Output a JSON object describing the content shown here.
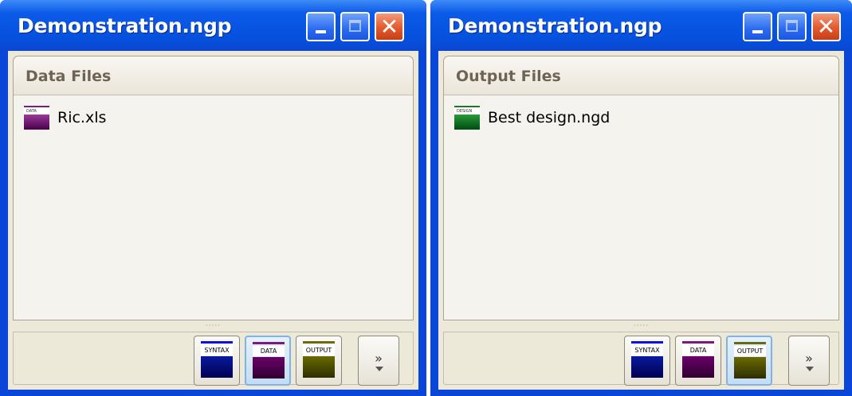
{
  "windows": [
    {
      "title": "Demonstration.ngp",
      "panel_title": "Data Files",
      "file": {
        "name": "Ric.xls",
        "icon": "data-file-icon",
        "icon_label": "DATA",
        "color": "#6b0a6b"
      },
      "toolbar": {
        "buttons": [
          {
            "label": "SYNTAX",
            "stripe": "#1010e0",
            "fill": "#00108a",
            "active": false
          },
          {
            "label": "DATA",
            "stripe": "#7a1c7a",
            "fill": "#5e005e",
            "active": true
          },
          {
            "label": "OUTPUT",
            "stripe": "#6b6a10",
            "fill": "#5a5a00",
            "active": false
          }
        ],
        "more": "»"
      }
    },
    {
      "title": "Demonstration.ngp",
      "panel_title": "Output Files",
      "file": {
        "name": "Best design.ngd",
        "icon": "design-file-icon",
        "icon_label": "DESIGN",
        "color": "#0a6b1a"
      },
      "toolbar": {
        "buttons": [
          {
            "label": "SYNTAX",
            "stripe": "#1010e0",
            "fill": "#00108a",
            "active": false
          },
          {
            "label": "DATA",
            "stripe": "#7a1c7a",
            "fill": "#5e005e",
            "active": false
          },
          {
            "label": "OUTPUT",
            "stripe": "#6b6a10",
            "fill": "#5a5a00",
            "active": true
          }
        ],
        "more": "»"
      }
    }
  ],
  "colors": {
    "titlebar": "#0552e0",
    "window_body": "#ece9d8",
    "panel_title_text": "#6f6454"
  }
}
